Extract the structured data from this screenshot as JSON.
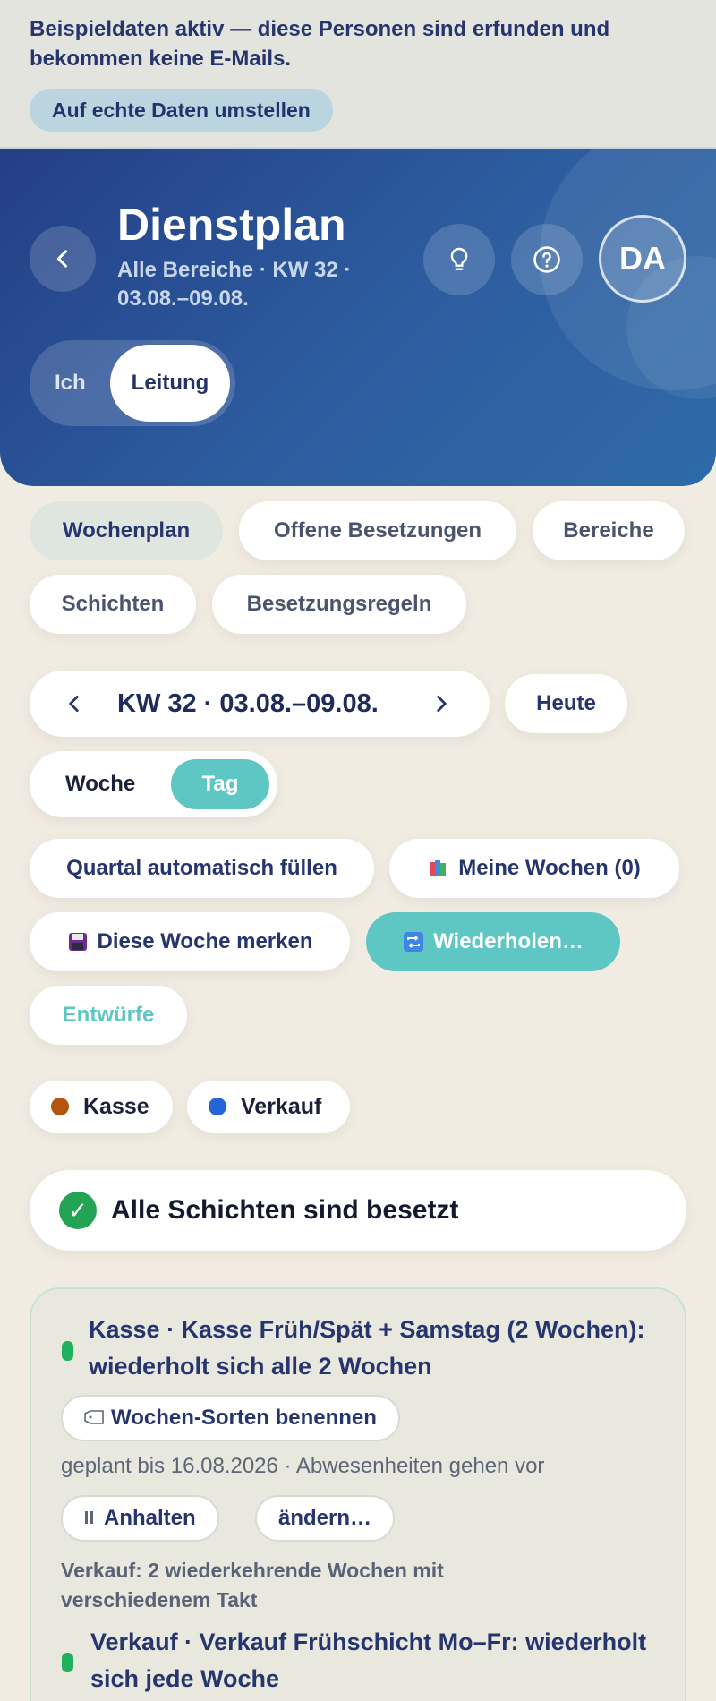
{
  "banner": {
    "text": "Beispieldaten aktiv — diese Personen sind erfunden und bekommen keine E-Mails.",
    "button": "Auf echte Daten umstellen"
  },
  "header": {
    "title": "Dienstplan",
    "subtitle": "Alle Bereiche · KW 32 · 03.08.–09.08.",
    "avatar": "DA",
    "role_ich": "Ich",
    "role_leitung": "Leitung"
  },
  "tabs": [
    "Wochenplan",
    "Offene Besetzungen",
    "Bereiche",
    "Schichten",
    "Besetzungsregeln"
  ],
  "week": {
    "label": "KW 32 · 03.08.–09.08.",
    "today": "Heute"
  },
  "view": {
    "woche": "Woche",
    "tag": "Tag"
  },
  "actions": {
    "auto_fill": "Quartal automatisch füllen",
    "my_weeks": "Meine Wochen (0)",
    "remember": "Diese Woche merken",
    "repeat": "Wiederholen…",
    "drafts": "Entwürfe"
  },
  "legend": [
    {
      "label": "Kasse",
      "color": "#b5530f"
    },
    {
      "label": "Verkauf",
      "color": "#2563d9"
    }
  ],
  "status": {
    "text": "Alle Schichten sind besetzt"
  },
  "recurrence": {
    "title": "Kasse · Kasse Früh/Spät + Samstag (2 Wochen): wiederholt sich alle 2 Wochen",
    "name_button": "Wochen-Sorten benennen",
    "meta": "geplant bis 16.08.2026 · Abwesenheiten gehen vor",
    "pause": "Anhalten",
    "edit": "ändern…",
    "sub": "Verkauf: 2 wiederkehrende Wochen mit verschiedenem Takt",
    "second_title": "Verkauf · Verkauf Frühschicht Mo–Fr: wiederholt sich jede Woche"
  }
}
